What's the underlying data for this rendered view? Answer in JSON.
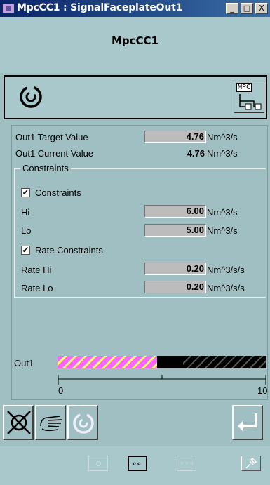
{
  "window": {
    "title": "MpcCC1 : SignalFaceplateOut1",
    "minimize": "_",
    "maximize": "□",
    "close": "X"
  },
  "header": {
    "name": "MpcCC1"
  },
  "icon_panel": {
    "mpc_label": "MPC"
  },
  "fields": {
    "target_label": "Out1 Target Value",
    "target_value": "4.76",
    "target_unit": "Nm^3/s",
    "current_label": "Out1 Current Value",
    "current_value": "4.76",
    "current_unit": "Nm^3/s"
  },
  "constraints": {
    "legend": "Constraints",
    "enable_label": "Constraints",
    "enable_checked": true,
    "hi_label": "Hi",
    "hi_value": "6.00",
    "hi_unit": "Nm^3/s",
    "lo_label": "Lo",
    "lo_value": "5.00",
    "lo_unit": "Nm^3/s",
    "rate_label": "Rate Constraints",
    "rate_checked": true,
    "rate_hi_label": "Rate Hi",
    "rate_hi_value": "0.20",
    "rate_hi_unit": "Nm^3/s/s",
    "rate_lo_label": "Rate Lo",
    "rate_lo_value": "0.20",
    "rate_lo_unit": "Nm^3/s/s"
  },
  "bar": {
    "label": "Out1",
    "min_label": "0",
    "max_label": "10",
    "fill_fraction": 0.476,
    "marker_fraction": 0.6,
    "colors": {
      "fill": "#ff66ff",
      "stripe": "#ffff66",
      "empty": "#000000"
    }
  },
  "toolbar": {
    "icons": [
      "stop-icon",
      "manual-hand-icon",
      "auto-swirl-icon",
      "enter-icon"
    ]
  },
  "bottom": {
    "icons": [
      "single-dot-icon",
      "double-dot-icon",
      "triple-dot-icon",
      "pin-icon"
    ]
  }
}
